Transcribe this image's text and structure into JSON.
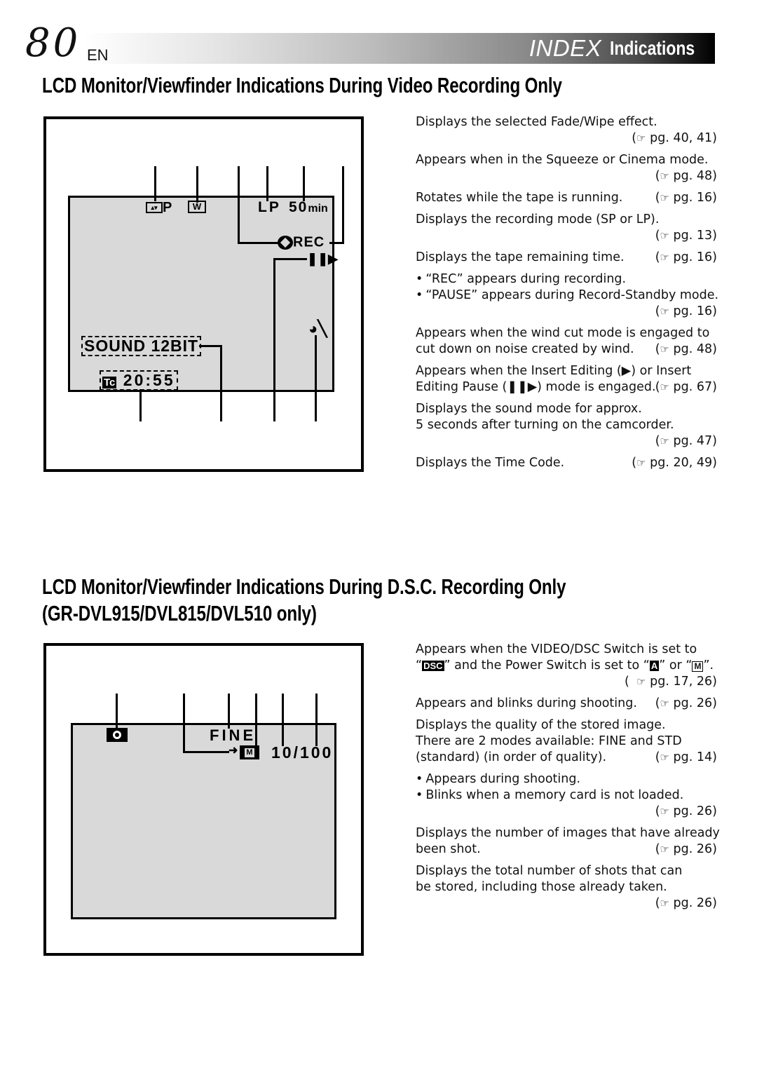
{
  "header": {
    "page_number": "80",
    "language": "EN",
    "section_italic": "INDEX",
    "section_label": "Indications"
  },
  "video_section": {
    "title": "LCD Monitor/Viewfinder Indications During Video Recording Only",
    "osd": {
      "fade_wipe_suffix": "P",
      "squeeze_icon_letter": "W",
      "rec_mode": "LP",
      "remaining_value": "50",
      "remaining_unit": "min",
      "rec_status": "REC",
      "sound_mode": "SOUND 12BIT",
      "timecode_prefix": "Tc",
      "timecode": "20:55"
    },
    "descriptions": [
      {
        "lines": [
          "Displays the selected Fade/Wipe effect."
        ],
        "ref": "pg. 40, 41",
        "ref_own_line": true
      },
      {
        "lines": [
          "Appears when in the Squeeze or Cinema mode."
        ],
        "ref": "pg. 48",
        "ref_own_line": true
      },
      {
        "lines": [
          "Rotates while the tape is running."
        ],
        "ref": "pg. 16",
        "ref_own_line": false
      },
      {
        "lines": [
          "Displays the recording mode (SP or LP)."
        ],
        "ref": "pg. 13",
        "ref_own_line": true
      },
      {
        "lines": [
          "Displays the tape remaining time."
        ],
        "ref": "pg. 16",
        "ref_own_line": false
      },
      {
        "bullets": [
          "“REC” appears during recording.",
          "“PAUSE” appears during Record-Standby mode."
        ],
        "ref": "pg. 16",
        "ref_own_line": true
      },
      {
        "lines": [
          "Appears when the wind cut mode is engaged to",
          "cut down on noise created by wind."
        ],
        "ref": "pg. 48",
        "ref_own_line": false
      },
      {
        "lines": [
          "Appears when the Insert Editing (▶) or Insert",
          "Editing Pause (❚❚▶) mode is engaged."
        ],
        "ref": "pg. 67",
        "ref_own_line": false
      },
      {
        "lines": [
          "Displays the sound mode for approx.",
          "5 seconds after turning on the camcorder."
        ],
        "ref": "pg. 47",
        "ref_own_line": true
      },
      {
        "lines": [
          "Displays the Time Code."
        ],
        "ref": "pg. 20, 49",
        "ref_own_line": false
      }
    ]
  },
  "dsc_section": {
    "title_line1": "LCD Monitor/Viewfinder Indications During D.S.C. Recording Only",
    "title_line2": "(GR-DVL915/DVL815/DVL510 only)",
    "osd": {
      "quality": "FINE",
      "card_icon_letter": "M",
      "shot_count": "10/100"
    },
    "descriptions": {
      "d1_line1": "Appears when the VIDEO/DSC Switch is set to",
      "d1_line2_a": "“",
      "d1_icon_dsc": "DSC",
      "d1_line2_b": "” and the Power Switch is set to “",
      "d1_icon_a": "A",
      "d1_line2_c": "” or “",
      "d1_icon_m": "M",
      "d1_line2_d": "”.",
      "d1_ref": "pg. 17, 26",
      "d2_line1": "Appears and blinks during shooting.",
      "d2_ref": "pg. 26",
      "d3_line1": "Displays the quality of the stored image.",
      "d3_line2": "There are 2 modes available: FINE and STD",
      "d3_line3": "(standard) (in order of quality).",
      "d3_ref": "pg. 14",
      "d4_bullet1": "Appears during shooting.",
      "d4_bullet2": "Blinks when a memory card is not loaded.",
      "d4_ref": "pg. 26",
      "d5_line1": "Displays the number of images that have already",
      "d5_line2": "been shot.",
      "d5_ref": "pg. 26",
      "d6_line1": "Displays the total number of shots that can",
      "d6_line2": "be stored, including those already taken.",
      "d6_ref": "pg. 26"
    }
  },
  "ref_icon": "☞"
}
